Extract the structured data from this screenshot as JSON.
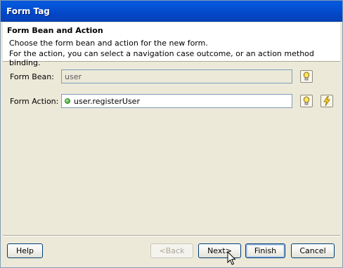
{
  "window": {
    "title": "Form Tag"
  },
  "header": {
    "title": "Form Bean and Action",
    "description_line1": "Choose the form bean and action for the new form.",
    "description_line2": "For the action, you can select a navigation case outcome, or an action method binding."
  },
  "form": {
    "bean_label": "Form Bean:",
    "bean_value": "user",
    "action_label": "Form Action:",
    "action_value": "user.registerUser"
  },
  "icons": {
    "bean_browse": "lightbulb-icon",
    "action_browse": "lightbulb-icon",
    "action_method": "lightning-icon"
  },
  "buttons": {
    "help": "Help",
    "back": "<Back",
    "next": "Next>",
    "finish": "Finish",
    "cancel": "Cancel"
  },
  "colors": {
    "title_bar": "#0458dd",
    "dialog_bg": "#ece9d8",
    "status_ok": "#4fb43a"
  }
}
